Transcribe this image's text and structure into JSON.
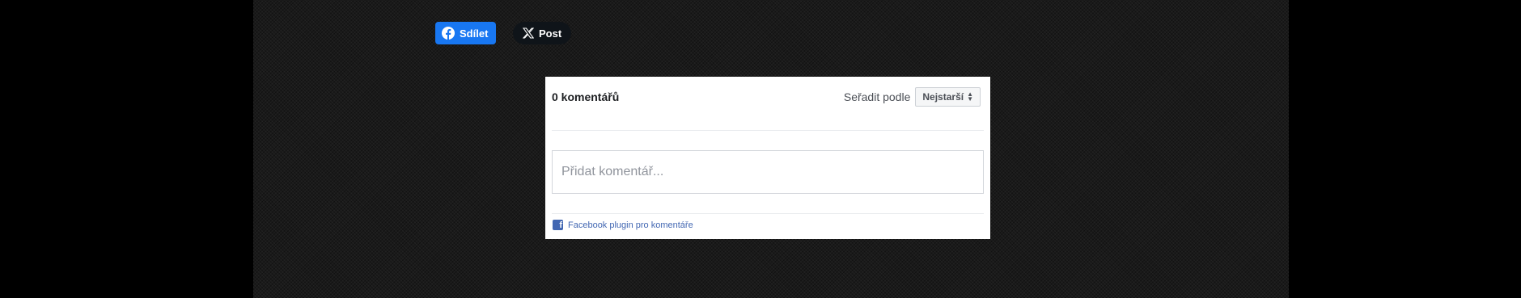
{
  "share": {
    "facebook_label": "Sdílet",
    "facebook_icon": "facebook-icon",
    "x_label": "Post",
    "x_icon": "x-logo-icon"
  },
  "comments": {
    "count_label": "0 komentářů",
    "sort_label": "Seřadit podle",
    "sort_selected": "Nejstarší",
    "input_placeholder": "Přidat komentář...",
    "plugin_label": "Facebook plugin pro komentáře"
  },
  "colors": {
    "facebook_blue": "#1877f2",
    "plugin_link": "#4267b2",
    "x_black": "#0f1419"
  }
}
